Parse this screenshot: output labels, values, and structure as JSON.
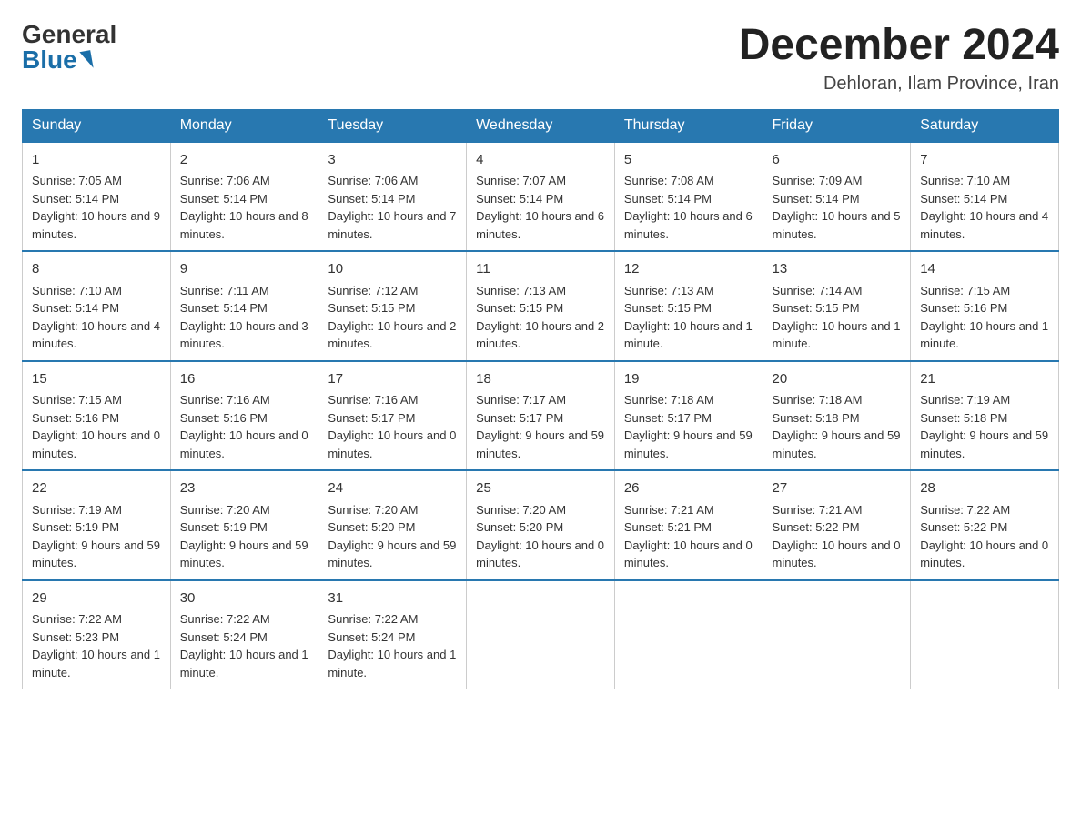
{
  "logo": {
    "general": "General",
    "blue": "Blue"
  },
  "header": {
    "month": "December 2024",
    "location": "Dehloran, Ilam Province, Iran"
  },
  "days_of_week": [
    "Sunday",
    "Monday",
    "Tuesday",
    "Wednesday",
    "Thursday",
    "Friday",
    "Saturday"
  ],
  "weeks": [
    [
      {
        "day": "1",
        "sunrise": "7:05 AM",
        "sunset": "5:14 PM",
        "daylight": "10 hours and 9 minutes."
      },
      {
        "day": "2",
        "sunrise": "7:06 AM",
        "sunset": "5:14 PM",
        "daylight": "10 hours and 8 minutes."
      },
      {
        "day": "3",
        "sunrise": "7:06 AM",
        "sunset": "5:14 PM",
        "daylight": "10 hours and 7 minutes."
      },
      {
        "day": "4",
        "sunrise": "7:07 AM",
        "sunset": "5:14 PM",
        "daylight": "10 hours and 6 minutes."
      },
      {
        "day": "5",
        "sunrise": "7:08 AM",
        "sunset": "5:14 PM",
        "daylight": "10 hours and 6 minutes."
      },
      {
        "day": "6",
        "sunrise": "7:09 AM",
        "sunset": "5:14 PM",
        "daylight": "10 hours and 5 minutes."
      },
      {
        "day": "7",
        "sunrise": "7:10 AM",
        "sunset": "5:14 PM",
        "daylight": "10 hours and 4 minutes."
      }
    ],
    [
      {
        "day": "8",
        "sunrise": "7:10 AM",
        "sunset": "5:14 PM",
        "daylight": "10 hours and 4 minutes."
      },
      {
        "day": "9",
        "sunrise": "7:11 AM",
        "sunset": "5:14 PM",
        "daylight": "10 hours and 3 minutes."
      },
      {
        "day": "10",
        "sunrise": "7:12 AM",
        "sunset": "5:15 PM",
        "daylight": "10 hours and 2 minutes."
      },
      {
        "day": "11",
        "sunrise": "7:13 AM",
        "sunset": "5:15 PM",
        "daylight": "10 hours and 2 minutes."
      },
      {
        "day": "12",
        "sunrise": "7:13 AM",
        "sunset": "5:15 PM",
        "daylight": "10 hours and 1 minute."
      },
      {
        "day": "13",
        "sunrise": "7:14 AM",
        "sunset": "5:15 PM",
        "daylight": "10 hours and 1 minute."
      },
      {
        "day": "14",
        "sunrise": "7:15 AM",
        "sunset": "5:16 PM",
        "daylight": "10 hours and 1 minute."
      }
    ],
    [
      {
        "day": "15",
        "sunrise": "7:15 AM",
        "sunset": "5:16 PM",
        "daylight": "10 hours and 0 minutes."
      },
      {
        "day": "16",
        "sunrise": "7:16 AM",
        "sunset": "5:16 PM",
        "daylight": "10 hours and 0 minutes."
      },
      {
        "day": "17",
        "sunrise": "7:16 AM",
        "sunset": "5:17 PM",
        "daylight": "10 hours and 0 minutes."
      },
      {
        "day": "18",
        "sunrise": "7:17 AM",
        "sunset": "5:17 PM",
        "daylight": "9 hours and 59 minutes."
      },
      {
        "day": "19",
        "sunrise": "7:18 AM",
        "sunset": "5:17 PM",
        "daylight": "9 hours and 59 minutes."
      },
      {
        "day": "20",
        "sunrise": "7:18 AM",
        "sunset": "5:18 PM",
        "daylight": "9 hours and 59 minutes."
      },
      {
        "day": "21",
        "sunrise": "7:19 AM",
        "sunset": "5:18 PM",
        "daylight": "9 hours and 59 minutes."
      }
    ],
    [
      {
        "day": "22",
        "sunrise": "7:19 AM",
        "sunset": "5:19 PM",
        "daylight": "9 hours and 59 minutes."
      },
      {
        "day": "23",
        "sunrise": "7:20 AM",
        "sunset": "5:19 PM",
        "daylight": "9 hours and 59 minutes."
      },
      {
        "day": "24",
        "sunrise": "7:20 AM",
        "sunset": "5:20 PM",
        "daylight": "9 hours and 59 minutes."
      },
      {
        "day": "25",
        "sunrise": "7:20 AM",
        "sunset": "5:20 PM",
        "daylight": "10 hours and 0 minutes."
      },
      {
        "day": "26",
        "sunrise": "7:21 AM",
        "sunset": "5:21 PM",
        "daylight": "10 hours and 0 minutes."
      },
      {
        "day": "27",
        "sunrise": "7:21 AM",
        "sunset": "5:22 PM",
        "daylight": "10 hours and 0 minutes."
      },
      {
        "day": "28",
        "sunrise": "7:22 AM",
        "sunset": "5:22 PM",
        "daylight": "10 hours and 0 minutes."
      }
    ],
    [
      {
        "day": "29",
        "sunrise": "7:22 AM",
        "sunset": "5:23 PM",
        "daylight": "10 hours and 1 minute."
      },
      {
        "day": "30",
        "sunrise": "7:22 AM",
        "sunset": "5:24 PM",
        "daylight": "10 hours and 1 minute."
      },
      {
        "day": "31",
        "sunrise": "7:22 AM",
        "sunset": "5:24 PM",
        "daylight": "10 hours and 1 minute."
      },
      null,
      null,
      null,
      null
    ]
  ],
  "labels": {
    "sunrise": "Sunrise:",
    "sunset": "Sunset:",
    "daylight": "Daylight:"
  }
}
